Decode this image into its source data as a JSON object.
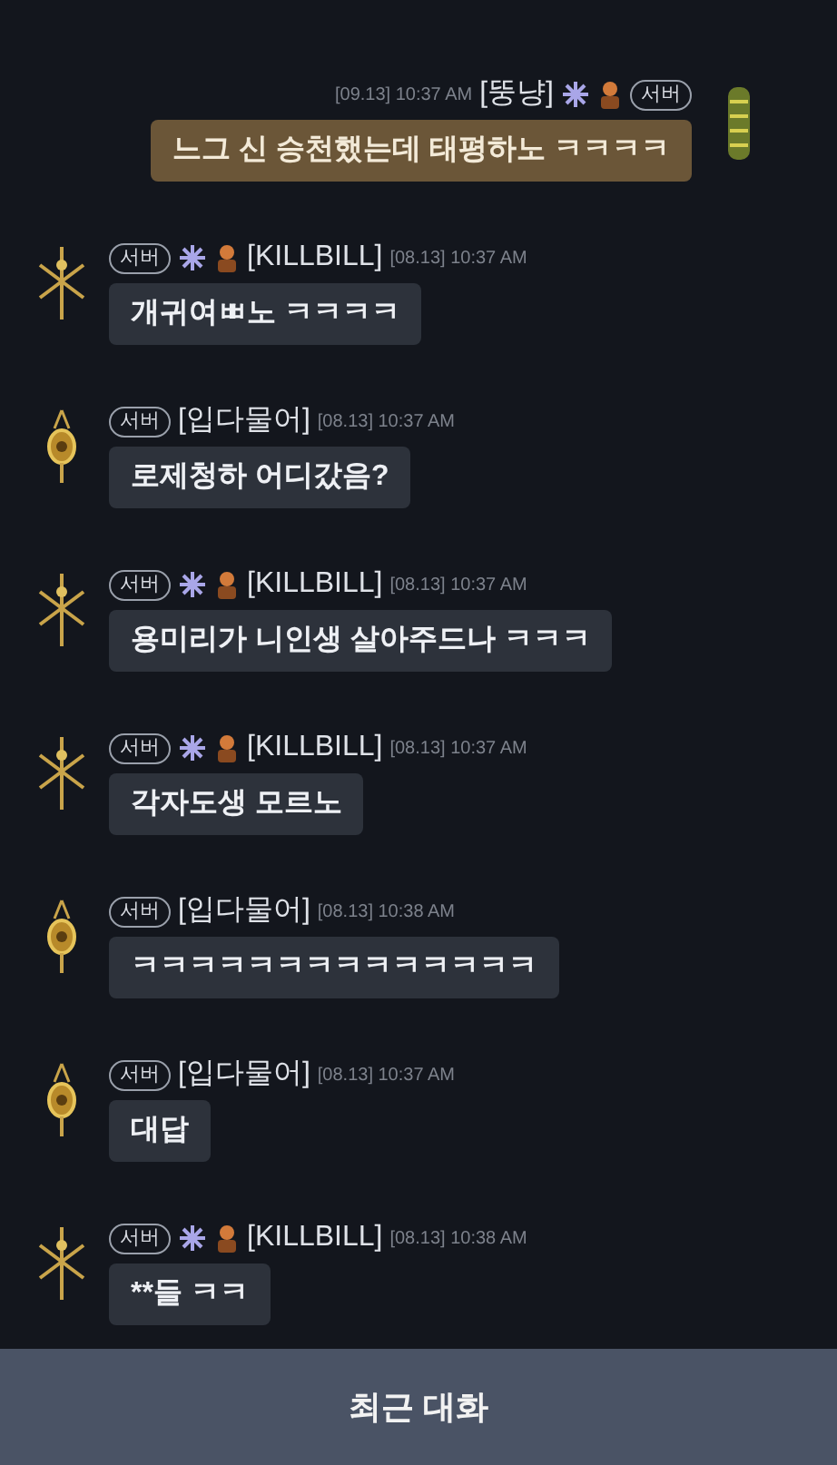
{
  "messages": [
    {
      "kind": "mine",
      "avatar": {
        "kind": "lantern"
      },
      "badge": "서버",
      "name": "[뚱냥]",
      "time": "[09.13] 10:37 AM",
      "emblems": [
        {
          "kind": "figure"
        },
        {
          "kind": "crest"
        }
      ],
      "text": "느그 신 승천했는데 태평하노 ㅋㅋㅋㅋ"
    },
    {
      "kind": "other",
      "avatar": {
        "kind": "sword"
      },
      "badge": "서버",
      "name": "[KILLBILL]",
      "time": "[08.13] 10:37 AM",
      "emblems": [
        {
          "kind": "crest"
        },
        {
          "kind": "figure"
        }
      ],
      "text": "개귀여ㅃ노 ㅋㅋㅋㅋ"
    },
    {
      "kind": "other",
      "avatar": {
        "kind": "amulet"
      },
      "badge": "서버",
      "name": "[입다물어]",
      "time": "[08.13] 10:37 AM",
      "text": "로제청하 어디갔음?"
    },
    {
      "kind": "other",
      "avatar": {
        "kind": "sword"
      },
      "badge": "서버",
      "name": "[KILLBILL]",
      "time": "[08.13] 10:37 AM",
      "emblems": [
        {
          "kind": "crest"
        },
        {
          "kind": "figure"
        }
      ],
      "text": "용미리가 니인생 살아주드나 ㅋㅋㅋ"
    },
    {
      "kind": "other",
      "avatar": {
        "kind": "sword"
      },
      "badge": "서버",
      "name": "[KILLBILL]",
      "time": "[08.13] 10:37 AM",
      "emblems": [
        {
          "kind": "crest"
        },
        {
          "kind": "figure"
        }
      ],
      "text": "각자도생 모르노"
    },
    {
      "kind": "other",
      "avatar": {
        "kind": "amulet"
      },
      "badge": "서버",
      "name": "[입다물어]",
      "time": "[08.13] 10:38 AM",
      "text": "ㅋㅋㅋㅋㅋㅋㅋㅋㅋㅋㅋㅋㅋㅋ"
    },
    {
      "kind": "other",
      "avatar": {
        "kind": "amulet"
      },
      "badge": "서버",
      "name": "[입다물어]",
      "time": "[08.13] 10:37 AM",
      "text": "대답"
    },
    {
      "kind": "other",
      "avatar": {
        "kind": "sword"
      },
      "badge": "서버",
      "name": "[KILLBILL]",
      "time": "[08.13] 10:38 AM",
      "emblems": [
        {
          "kind": "crest"
        },
        {
          "kind": "figure"
        }
      ],
      "text": "**들 ㅋㅋ"
    }
  ],
  "recent_chat_button": {
    "label": "최근 대화"
  }
}
